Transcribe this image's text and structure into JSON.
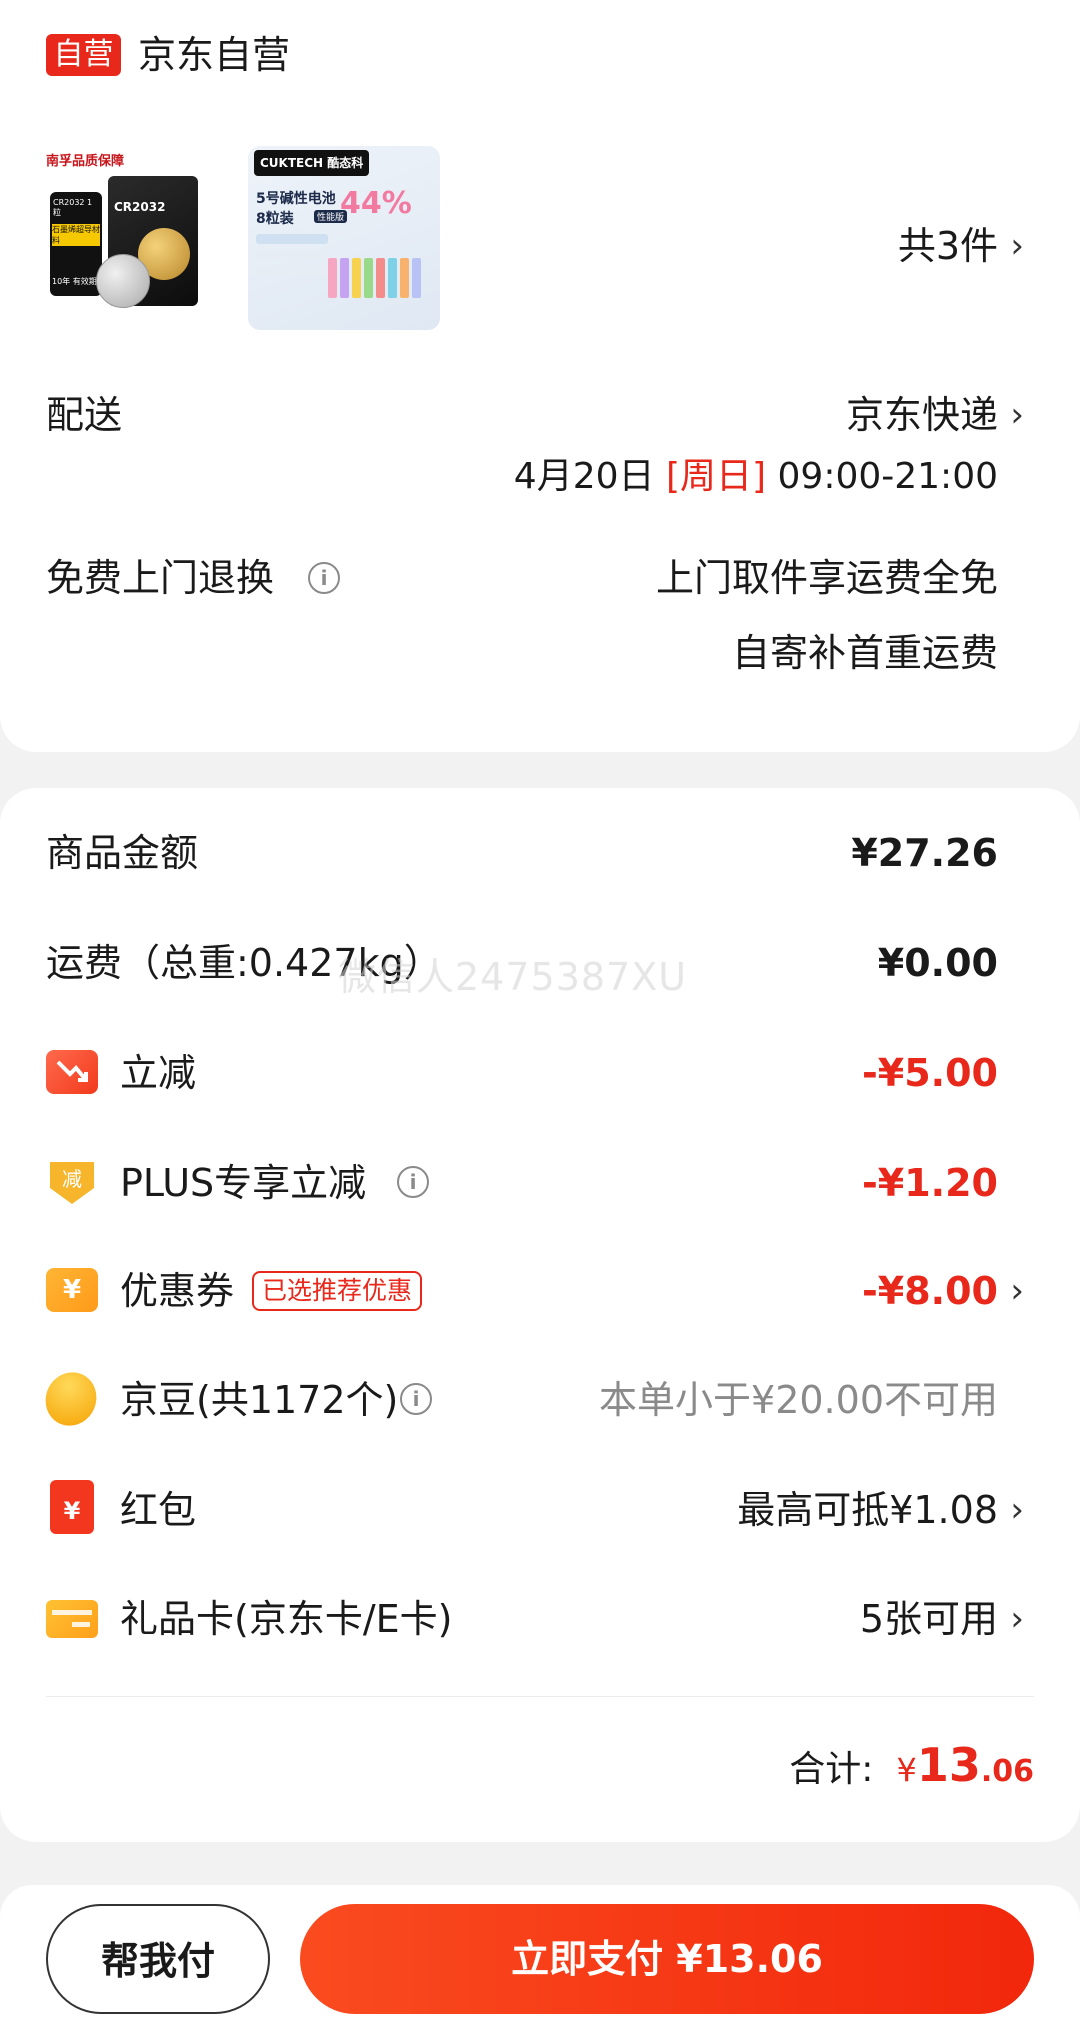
{
  "store": {
    "badge": "自营",
    "name": "京东自营"
  },
  "products": {
    "count_label": "共3件",
    "thumb1": {
      "brand": "南孚品质保障",
      "model": "CR2032 1粒",
      "line1": "石墨烯超导材料",
      "line2": "10年 有效期",
      "pack": "CR2032"
    },
    "thumb2": {
      "brand": "CUKTECH 酷态科",
      "title": "5号碱性电池",
      "sub": "8粒装",
      "tag": "性能版",
      "percent": "44%"
    }
  },
  "delivery": {
    "label": "配送",
    "carrier": "京东快递",
    "date": "4月20日",
    "weekday": "[周日]",
    "time": "09:00-21:00"
  },
  "returns": {
    "label": "免费上门退换",
    "line1": "上门取件享运费全免",
    "line2": "自寄补首重运费"
  },
  "summary": {
    "goods_label": "商品金额",
    "goods_value": "¥27.26",
    "shipping_label": "运费（总重:0.427kg）",
    "shipping_value": "¥0.00",
    "instant_label": "立减",
    "instant_value": "-¥5.00",
    "plus_label": "PLUS专享立减",
    "plus_value": "-¥1.20",
    "coupon_label": "优惠券",
    "coupon_tag": "已选推荐优惠",
    "coupon_value": "-¥8.00",
    "jingdou_label": "京豆(共1172个)",
    "jingdou_value": "本单小于¥20.00不可用",
    "hongbao_label": "红包",
    "hongbao_value": "最高可抵¥1.08",
    "giftcard_label": "礼品卡(京东卡/E卡)",
    "giftcard_value": "5张可用",
    "total_label": "合计:",
    "total_currency": "¥",
    "total_int": "13",
    "total_dec": ".06"
  },
  "watermark": "微信人2475387XU",
  "bottom": {
    "help_pay": "帮我付",
    "pay_now": "立即支付 ¥13.06"
  },
  "colors": {
    "accent": "#e8281b",
    "pay_button": "#f2270c"
  }
}
